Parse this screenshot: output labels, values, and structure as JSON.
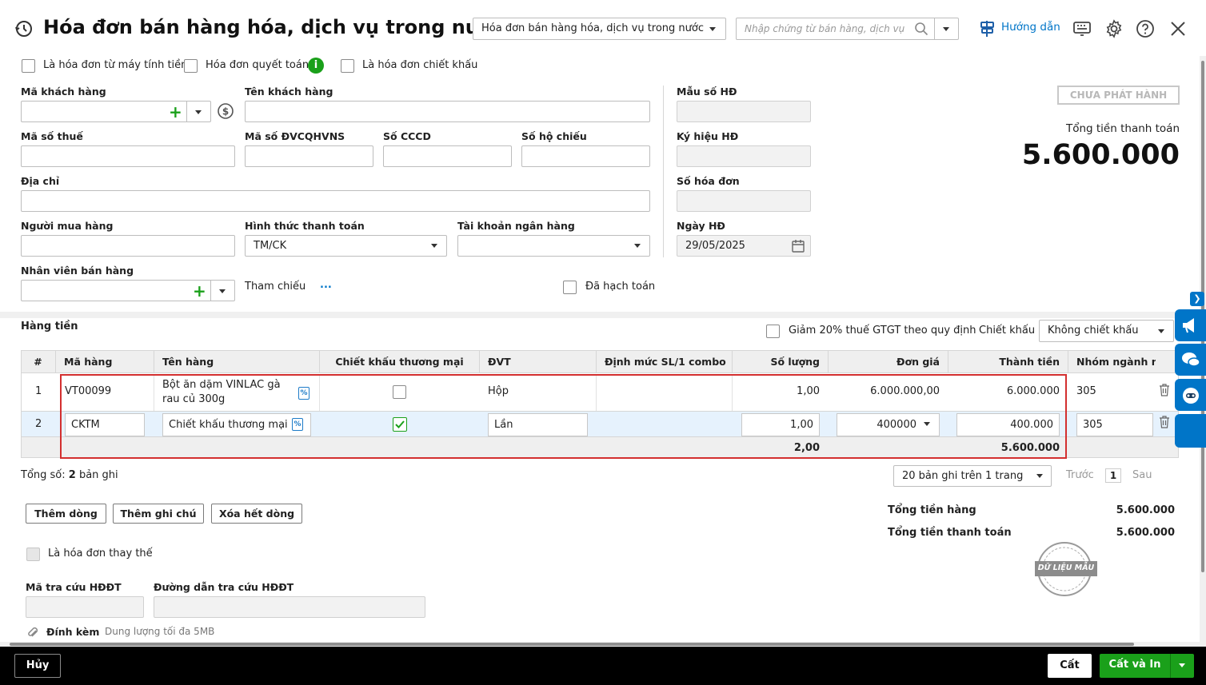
{
  "header": {
    "title": "Hóa đơn bán hàng hóa, dịch vụ trong nước",
    "invoice_type_select": "Hóa đơn bán hàng hóa, dịch vụ trong nước",
    "search_placeholder": "Nhập chứng từ bán hàng, dịch vụ",
    "guide_label": "Hướng dẫn"
  },
  "options": {
    "cash_register": "Là hóa đơn từ máy tính tiền",
    "settlement": "Hóa đơn quyết toán",
    "discount_invoice": "Là hóa đơn chiết khấu"
  },
  "form": {
    "customer_code_label": "Mã khách hàng",
    "customer_name_label": "Tên khách hàng",
    "tax_code_label": "Mã số thuế",
    "budget_code_label": "Mã số ĐVCQHVNS",
    "cccd_label": "Số CCCD",
    "passport_label": "Số hộ chiếu",
    "address_label": "Địa chỉ",
    "buyer_label": "Người mua hàng",
    "payment_label": "Hình thức thanh toán",
    "payment_value": "TM/CK",
    "bank_label": "Tài khoản ngân hàng",
    "salesperson_label": "Nhân viên bán hàng",
    "reference_label": "Tham chiếu",
    "reference_link": "...",
    "posted_label": "Đã hạch toán"
  },
  "invoice_meta": {
    "template_label": "Mẫu số HĐ",
    "symbol_label": "Ký hiệu HĐ",
    "number_label": "Số hóa đơn",
    "date_label": "Ngày HĐ",
    "date_value": "29/05/2025",
    "status_button": "CHƯA PHÁT HÀNH",
    "total_label": "Tổng tiền thanh toán",
    "total_value": "5.600.000"
  },
  "goods": {
    "section_title": "Hàng tiền",
    "vat_reduction_label": "Giảm 20% thuế GTGT theo quy định",
    "discount_label": "Chiết khấu",
    "discount_value": "Không chiết khấu",
    "columns": [
      "#",
      "Mã hàng",
      "Tên hàng",
      "Chiết khấu thương mại",
      "ĐVT",
      "Định mức SL/1 combo",
      "Số lượng",
      "Đơn giá",
      "Thành tiền",
      "Nhóm ngành ng"
    ],
    "rows": [
      {
        "no": "1",
        "code": "VT00099",
        "name": "Bột ăn dặm VINLAC gà rau củ 300g",
        "unit": "Hộp",
        "qty": "1,00",
        "price": "6.000.000,00",
        "amount": "6.000.000",
        "group": "305",
        "commercial_discount": false
      },
      {
        "no": "2",
        "code": "CKTM",
        "name": "Chiết khấu thương mại",
        "unit": "Lần",
        "qty": "1,00",
        "price": "400000",
        "amount": "400.000",
        "group": "305",
        "commercial_discount": true
      }
    ],
    "total_qty": "2,00",
    "total_amount": "5.600.000",
    "record_count_prefix": "Tổng số:",
    "record_count": "2",
    "record_count_suffix": "bản ghi",
    "page_size": "20 bản ghi trên 1 trang",
    "prev": "Trước",
    "page": "1",
    "next": "Sau"
  },
  "actions": {
    "add_row": "Thêm dòng",
    "add_note": "Thêm ghi chú",
    "delete_all": "Xóa hết dòng"
  },
  "summary": {
    "goods_total_label": "Tổng tiền hàng",
    "goods_total_value": "5.600.000",
    "payment_total_label": "Tổng tiền thanh toán",
    "payment_total_value": "5.600.000",
    "stamp_text": "DỮ LIỆU MẪU"
  },
  "replace": {
    "replace_label": "Là hóa đơn thay thế",
    "lookup_code_label": "Mã tra cứu HĐĐT",
    "lookup_url_label": "Đường dẫn tra cứu HĐĐT",
    "attach_label": "Đính kèm",
    "attach_hint": "Dung lượng tối đa 5MB"
  },
  "footer": {
    "cancel": "Hủy",
    "save": "Cất",
    "save_print": "Cất và In"
  },
  "colors": {
    "primary": "#0075c8",
    "green": "#1aa01a",
    "highlight": "#d32f2f",
    "footer_bg": "#000000"
  }
}
